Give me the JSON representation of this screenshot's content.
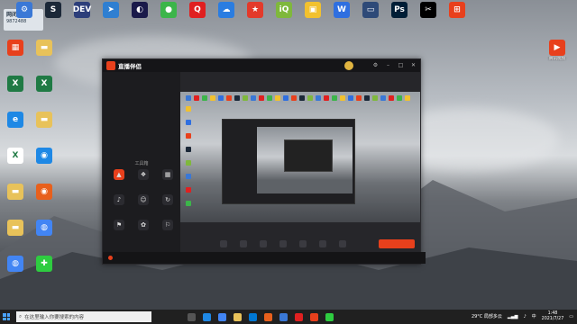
{
  "desktop": {
    "notice": {
      "line1": "网闭网",
      "line2": "9872488"
    },
    "top_icons": [
      {
        "label": "",
        "color": "#3a78d6",
        "glyph": "⚙"
      },
      {
        "label": "",
        "color": "#1b2838",
        "glyph": "S"
      },
      {
        "label": "",
        "color": "#2c3e7a",
        "glyph": "DEV"
      },
      {
        "label": "",
        "color": "#2f7fd1",
        "glyph": "➤"
      },
      {
        "label": "",
        "color": "#1a1a4a",
        "glyph": "◐"
      },
      {
        "label": "",
        "color": "#3cb54a",
        "glyph": "●"
      },
      {
        "label": "",
        "color": "#e02020",
        "glyph": "Q"
      },
      {
        "label": "",
        "color": "#2a7de1",
        "glyph": "☁"
      },
      {
        "label": "",
        "color": "#e33a2b",
        "glyph": "★"
      },
      {
        "label": "",
        "color": "#7fb83c",
        "glyph": "iQ"
      },
      {
        "label": "",
        "color": "#f2c12e",
        "glyph": "▣"
      },
      {
        "label": "",
        "color": "#2f6fe0",
        "glyph": "W"
      },
      {
        "label": "",
        "color": "#2e4a78",
        "glyph": "▭"
      },
      {
        "label": "",
        "color": "#001e36",
        "glyph": "Ps"
      },
      {
        "label": "",
        "color": "#000000",
        "glyph": "✂"
      },
      {
        "label": "",
        "color": "#e8401c",
        "glyph": "⊞"
      }
    ],
    "left_icons": [
      {
        "label": "",
        "color": "#e8401c",
        "glyph": "▦"
      },
      {
        "label": "",
        "color": "#e8c25a",
        "glyph": "▬"
      },
      {
        "label": "",
        "color": "#1f7a44",
        "glyph": "X"
      },
      {
        "label": "",
        "color": "#1f7a44",
        "glyph": "X"
      },
      {
        "label": "",
        "color": "#1e88e5",
        "glyph": "e"
      },
      {
        "label": "",
        "color": "#e8c25a",
        "glyph": "▬"
      },
      {
        "label": "",
        "color": "#ffffff",
        "glyph": "X"
      },
      {
        "label": "",
        "color": "#1e88e5",
        "glyph": "◉"
      },
      {
        "label": "",
        "color": "#e8c25a",
        "glyph": "▬"
      },
      {
        "label": "",
        "color": "#e8601c",
        "glyph": "◉"
      },
      {
        "label": "",
        "color": "#e8c25a",
        "glyph": "▬"
      },
      {
        "label": "",
        "color": "#4285f4",
        "glyph": "◍"
      },
      {
        "label": "",
        "color": "#4285f4",
        "glyph": "◍"
      },
      {
        "label": "",
        "color": "#2ecc40",
        "glyph": "✚"
      }
    ],
    "right_icon": {
      "label": "腾讯视频",
      "color": "#e8401c",
      "glyph": "▶"
    }
  },
  "app": {
    "name": "直播伴侣",
    "version": "",
    "tabs": [
      "",
      ""
    ],
    "selector": "",
    "tools_title": "工具箱",
    "tools": [
      {
        "label": "",
        "glyph": "▲"
      },
      {
        "label": "",
        "glyph": "❖"
      },
      {
        "label": "",
        "glyph": "▦"
      },
      {
        "label": "",
        "glyph": "♪"
      },
      {
        "label": "",
        "glyph": "☺"
      },
      {
        "label": "",
        "glyph": "↻"
      },
      {
        "label": "",
        "glyph": "⚑"
      },
      {
        "label": "",
        "glyph": "✿"
      },
      {
        "label": "",
        "glyph": "⚐"
      }
    ],
    "room_line1": "",
    "room_line2": "",
    "controls": [
      {
        "label": ""
      },
      {
        "label": ""
      },
      {
        "label": ""
      },
      {
        "label": ""
      },
      {
        "label": ""
      },
      {
        "label": ""
      },
      {
        "label": ""
      }
    ],
    "live_button": "",
    "status_text": ""
  },
  "taskbar": {
    "search_placeholder": "在这里输入你要搜索的内容",
    "weather": "29°C 局部多云",
    "time": "1:48",
    "date": "2021/7/27",
    "lang": "中"
  }
}
